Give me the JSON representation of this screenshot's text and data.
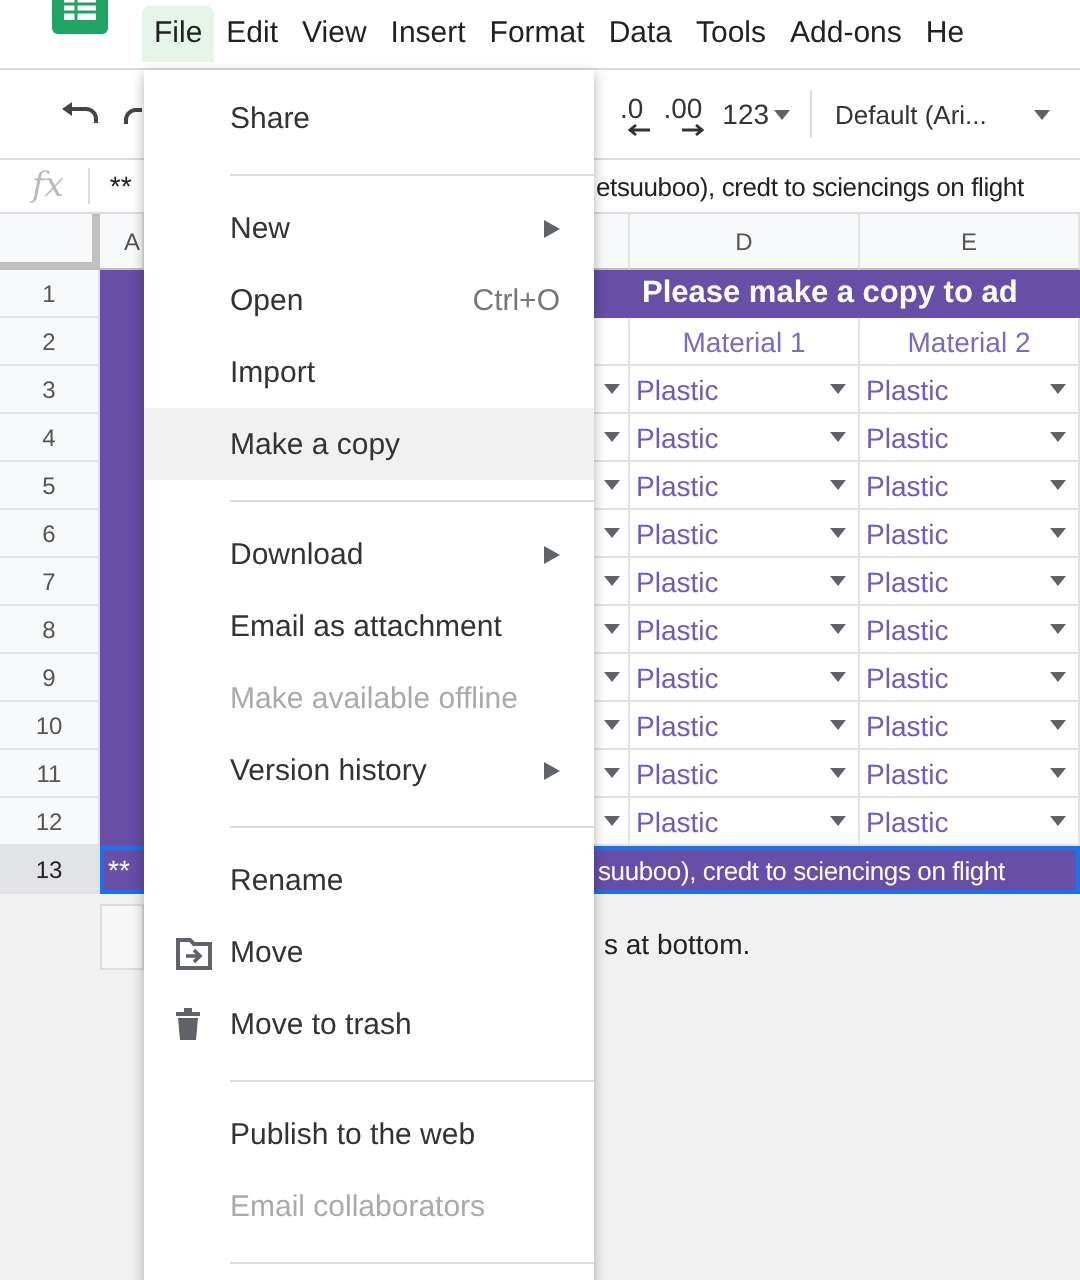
{
  "menubar": [
    {
      "label": "File",
      "selected": true
    },
    {
      "label": "Edit",
      "selected": false
    },
    {
      "label": "View",
      "selected": false
    },
    {
      "label": "Insert",
      "selected": false
    },
    {
      "label": "Format",
      "selected": false
    },
    {
      "label": "Data",
      "selected": false
    },
    {
      "label": "Tools",
      "selected": false
    },
    {
      "label": "Add-ons",
      "selected": false
    },
    {
      "label": "He",
      "selected": false
    }
  ],
  "toolbar": {
    "decimal_decrease": ".0",
    "decimal_increase": ".00",
    "number_format": "123",
    "font": "Default (Ari..."
  },
  "formula_bar": {
    "label": "fx",
    "left_text": "**",
    "right_text": "etsuuboo), credt to sciencings on flight"
  },
  "columns": [
    "A",
    "D",
    "E"
  ],
  "rows": [
    {
      "number": "1",
      "kind": "banner",
      "selected": false,
      "text": "Please make a copy to ad"
    },
    {
      "number": "2",
      "kind": "header",
      "selected": false,
      "cells": [
        "Material 1",
        "Material 2"
      ]
    },
    {
      "number": "3",
      "kind": "dropdowns",
      "selected": false,
      "cells": [
        "Plastic",
        "Plastic"
      ]
    },
    {
      "number": "4",
      "kind": "dropdowns",
      "selected": false,
      "cells": [
        "Plastic",
        "Plastic"
      ]
    },
    {
      "number": "5",
      "kind": "dropdowns",
      "selected": false,
      "cells": [
        "Plastic",
        "Plastic"
      ]
    },
    {
      "number": "6",
      "kind": "dropdowns",
      "selected": false,
      "cells": [
        "Plastic",
        "Plastic"
      ]
    },
    {
      "number": "7",
      "kind": "dropdowns",
      "selected": false,
      "cells": [
        "Plastic",
        "Plastic"
      ]
    },
    {
      "number": "8",
      "kind": "dropdowns",
      "selected": false,
      "cells": [
        "Plastic",
        "Plastic"
      ]
    },
    {
      "number": "9",
      "kind": "dropdowns",
      "selected": false,
      "cells": [
        "Plastic",
        "Plastic"
      ]
    },
    {
      "number": "10",
      "kind": "dropdowns",
      "selected": false,
      "cells": [
        "Plastic",
        "Plastic"
      ]
    },
    {
      "number": "11",
      "kind": "dropdowns",
      "selected": false,
      "cells": [
        "Plastic",
        "Plastic"
      ]
    },
    {
      "number": "12",
      "kind": "dropdowns",
      "selected": false,
      "cells": [
        "Plastic",
        "Plastic"
      ]
    },
    {
      "number": "13",
      "kind": "note",
      "selected": true,
      "left_text": "**",
      "right_text": "suuboo), credt to sciencings on flight"
    }
  ],
  "below_text": "s at bottom.",
  "file_menu": [
    {
      "kind": "item",
      "label": "Share",
      "selected": false,
      "disabled": false,
      "submenu": false
    },
    {
      "kind": "divider"
    },
    {
      "kind": "item",
      "label": "New",
      "selected": false,
      "disabled": false,
      "submenu": true
    },
    {
      "kind": "item",
      "label": "Open",
      "shortcut": "Ctrl+O",
      "selected": false,
      "disabled": false,
      "submenu": false
    },
    {
      "kind": "item",
      "label": "Import",
      "selected": false,
      "disabled": false,
      "submenu": false
    },
    {
      "kind": "item",
      "label": "Make a copy",
      "selected": true,
      "disabled": false,
      "submenu": false
    },
    {
      "kind": "divider"
    },
    {
      "kind": "item",
      "label": "Download",
      "selected": false,
      "disabled": false,
      "submenu": true
    },
    {
      "kind": "item",
      "label": "Email as attachment",
      "selected": false,
      "disabled": false,
      "submenu": false
    },
    {
      "kind": "item",
      "label": "Make available offline",
      "selected": false,
      "disabled": true,
      "submenu": false
    },
    {
      "kind": "item",
      "label": "Version history",
      "selected": false,
      "disabled": false,
      "submenu": true
    },
    {
      "kind": "divider"
    },
    {
      "kind": "item",
      "label": "Rename",
      "selected": false,
      "disabled": false,
      "submenu": false
    },
    {
      "kind": "folder",
      "label": "Move",
      "selected": false,
      "disabled": false,
      "submenu": false
    },
    {
      "kind": "trash",
      "label": "Move to trash",
      "selected": false,
      "disabled": false,
      "submenu": false
    },
    {
      "kind": "divider"
    },
    {
      "kind": "item",
      "label": "Publish to the web",
      "selected": false,
      "disabled": false,
      "submenu": false
    },
    {
      "kind": "item",
      "label": "Email collaborators",
      "selected": false,
      "disabled": true,
      "submenu": false
    },
    {
      "kind": "divider"
    }
  ]
}
